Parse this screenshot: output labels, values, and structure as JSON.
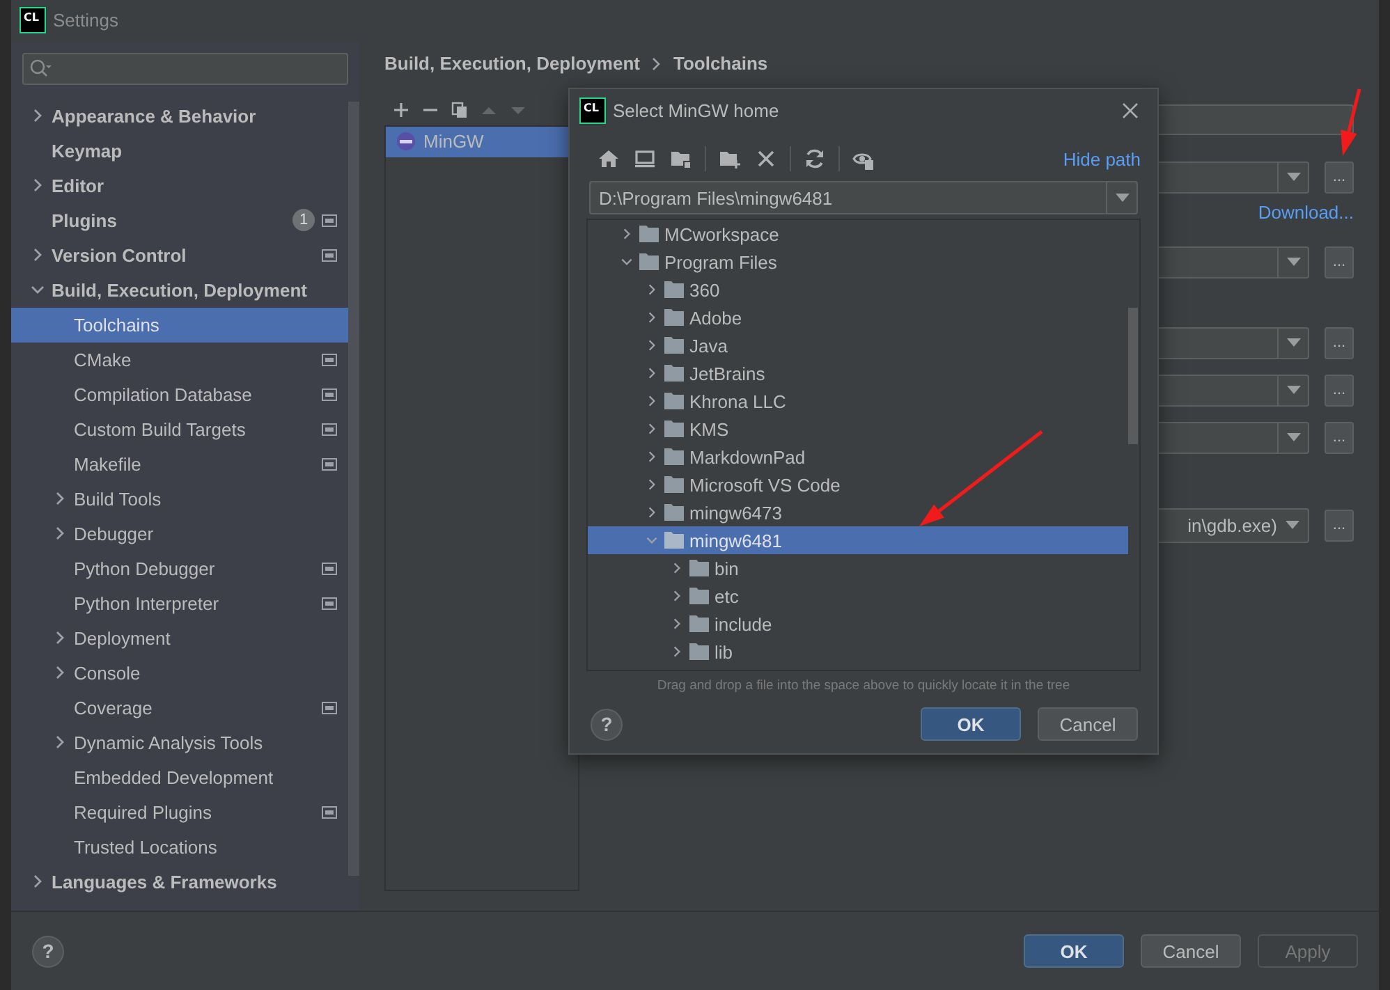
{
  "window": {
    "logo": "CL",
    "title": "Settings"
  },
  "sidebar": {
    "items": [
      {
        "label": "Appearance & Behavior",
        "expanded": false,
        "selected": false
      },
      {
        "label": "Keymap",
        "selected": false
      },
      {
        "label": "Editor",
        "expanded": false,
        "selected": false
      },
      {
        "label": "Plugins",
        "badge": "1",
        "project_level": true,
        "selected": false
      },
      {
        "label": "Version Control",
        "expanded": false,
        "project_level": true,
        "selected": false
      },
      {
        "label": "Build, Execution, Deployment",
        "expanded": true,
        "selected": false,
        "children": [
          {
            "label": "Toolchains",
            "selected": true
          },
          {
            "label": "CMake",
            "project_level": true,
            "selected": false
          },
          {
            "label": "Compilation Database",
            "project_level": true,
            "selected": false
          },
          {
            "label": "Custom Build Targets",
            "project_level": true,
            "selected": false
          },
          {
            "label": "Makefile",
            "project_level": true,
            "selected": false
          },
          {
            "label": "Build Tools",
            "expanded": false,
            "selected": false
          },
          {
            "label": "Debugger",
            "expanded": false,
            "selected": false
          },
          {
            "label": "Python Debugger",
            "project_level": true,
            "selected": false
          },
          {
            "label": "Python Interpreter",
            "project_level": true,
            "selected": false
          },
          {
            "label": "Deployment",
            "expanded": false,
            "selected": false
          },
          {
            "label": "Console",
            "expanded": false,
            "selected": false
          },
          {
            "label": "Coverage",
            "project_level": true,
            "selected": false
          },
          {
            "label": "Dynamic Analysis Tools",
            "expanded": false,
            "selected": false
          },
          {
            "label": "Embedded Development",
            "selected": false
          },
          {
            "label": "Required Plugins",
            "project_level": true,
            "selected": false
          },
          {
            "label": "Trusted Locations",
            "selected": false
          }
        ]
      },
      {
        "label": "Languages & Frameworks",
        "expanded": false,
        "selected": false
      }
    ]
  },
  "breadcrumb": [
    "Build, Execution, Deployment",
    "Toolchains"
  ],
  "toolchains": {
    "toolbar": [
      {
        "kind": "add",
        "disabled": false
      },
      {
        "kind": "remove",
        "disabled": false
      },
      {
        "kind": "copy",
        "disabled": false
      },
      {
        "kind": "up",
        "disabled": true
      },
      {
        "kind": "down",
        "disabled": true
      }
    ],
    "items": [
      {
        "name": "MinGW",
        "selected": true
      }
    ]
  },
  "fields": [
    {
      "kind": "text"
    },
    {
      "kind": "combo",
      "button": "..."
    },
    {
      "kind": "link",
      "label": "Download..."
    },
    {
      "kind": "combo",
      "button": "..."
    },
    {
      "kind": "combo",
      "button": "..."
    },
    {
      "kind": "combo",
      "button": "..."
    },
    {
      "kind": "combo",
      "button": "..."
    },
    {
      "kind": "combo",
      "value": "in\\gdb.exe)",
      "button": "..."
    }
  ],
  "dialog": {
    "logo": "CL",
    "title": "Select MinGW home",
    "toolbar_groups": [
      [
        {
          "kind": "home"
        },
        {
          "kind": "desktop"
        },
        {
          "kind": "project"
        }
      ],
      [
        {
          "kind": "new_folder"
        },
        {
          "kind": "delete"
        }
      ],
      [
        {
          "kind": "refresh"
        }
      ],
      [
        {
          "kind": "hidden"
        }
      ]
    ],
    "hide_path": "Hide path",
    "path": "D:\\Program Files\\mingw6481",
    "tree": [
      {
        "label": "MCworkspace",
        "expanded": false,
        "selected": false
      },
      {
        "label": "Program Files",
        "expanded": true,
        "selected": false,
        "children": [
          {
            "label": "360",
            "expanded": false,
            "selected": false
          },
          {
            "label": "Adobe",
            "expanded": false,
            "selected": false
          },
          {
            "label": "Java",
            "expanded": false,
            "selected": false
          },
          {
            "label": "JetBrains",
            "expanded": false,
            "selected": false
          },
          {
            "label": "Khrona LLC",
            "expanded": false,
            "selected": false
          },
          {
            "label": "KMS",
            "expanded": false,
            "selected": false
          },
          {
            "label": "MarkdownPad",
            "expanded": false,
            "selected": false
          },
          {
            "label": "Microsoft VS Code",
            "expanded": false,
            "selected": false
          },
          {
            "label": "mingw6473",
            "expanded": false,
            "selected": false
          },
          {
            "label": "mingw6481",
            "expanded": true,
            "selected": true,
            "children": [
              {
                "label": "bin",
                "expanded": false,
                "selected": false
              },
              {
                "label": "etc",
                "expanded": false,
                "selected": false
              },
              {
                "label": "include",
                "expanded": false,
                "selected": false
              },
              {
                "label": "lib",
                "expanded": false,
                "selected": false
              }
            ]
          }
        ]
      }
    ],
    "hint": "Drag and drop a file into the space above to quickly locate it in the tree",
    "help": "?",
    "buttons": [
      {
        "label": "OK",
        "default": true,
        "disabled": false
      },
      {
        "label": "Cancel",
        "default": false,
        "disabled": false
      }
    ]
  },
  "footer": {
    "help": "?",
    "buttons": [
      {
        "label": "OK",
        "default": true,
        "disabled": false
      },
      {
        "label": "Cancel",
        "default": false,
        "disabled": false
      },
      {
        "label": "Apply",
        "default": false,
        "disabled": true
      }
    ]
  }
}
